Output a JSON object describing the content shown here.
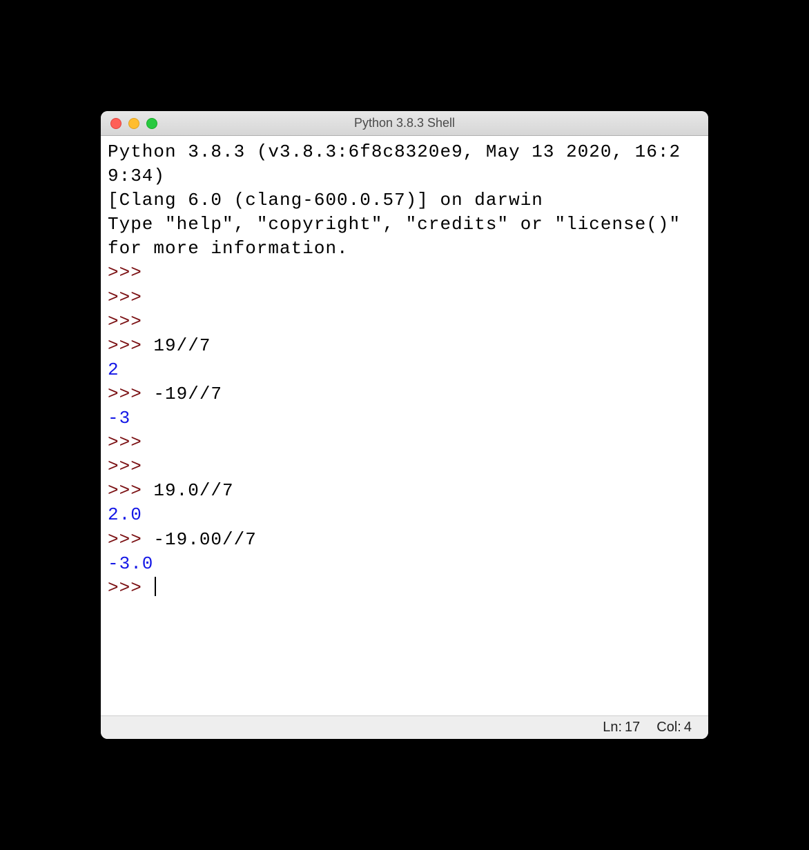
{
  "window": {
    "title": "Python 3.8.3 Shell"
  },
  "shell": {
    "banner_line1": "Python 3.8.3 (v3.8.3:6f8c8320e9, May 13 2020, 16:29:34) ",
    "banner_line2": "[Clang 6.0 (clang-600.0.57)] on darwin",
    "banner_line3": "Type \"help\", \"copyright\", \"credits\" or \"license()\" for more information.",
    "prompt": ">>> ",
    "lines": [
      {
        "type": "prompt",
        "input": ""
      },
      {
        "type": "prompt",
        "input": ""
      },
      {
        "type": "prompt",
        "input": ""
      },
      {
        "type": "prompt",
        "input": "19//7"
      },
      {
        "type": "output",
        "text": "2"
      },
      {
        "type": "prompt",
        "input": "-19//7"
      },
      {
        "type": "output",
        "text": "-3"
      },
      {
        "type": "prompt",
        "input": ""
      },
      {
        "type": "prompt",
        "input": ""
      },
      {
        "type": "prompt",
        "input": "19.0//7"
      },
      {
        "type": "output",
        "text": "2.0"
      },
      {
        "type": "prompt",
        "input": "-19.00//7"
      },
      {
        "type": "output",
        "text": "-3.0"
      },
      {
        "type": "prompt",
        "input": "",
        "cursor": true
      }
    ]
  },
  "status": {
    "ln_label": "Ln:",
    "ln_value": "17",
    "col_label": "Col:",
    "col_value": "4"
  }
}
